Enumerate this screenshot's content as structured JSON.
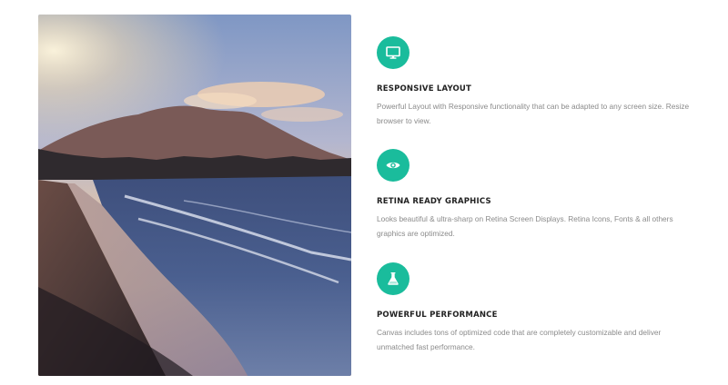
{
  "image": {
    "alt": "Beach at sunset with mountain"
  },
  "features": [
    {
      "icon": "monitor-icon",
      "title": "RESPONSIVE LAYOUT",
      "text": "Powerful Layout with Responsive functionality that can be adapted to any screen size. Resize browser to view."
    },
    {
      "icon": "eye-icon",
      "title": "RETINA READY GRAPHICS",
      "text": "Looks beautiful & ultra-sharp on Retina Screen Displays. Retina Icons, Fonts & all others graphics are optimized."
    },
    {
      "icon": "flask-icon",
      "title": "POWERFUL PERFORMANCE",
      "text": "Canvas includes tons of optimized code that are completely customizable and deliver unmatched fast performance."
    }
  ],
  "colors": {
    "accent": "#1abc9c",
    "title": "#222222",
    "body_text": "#8a8a8a"
  }
}
